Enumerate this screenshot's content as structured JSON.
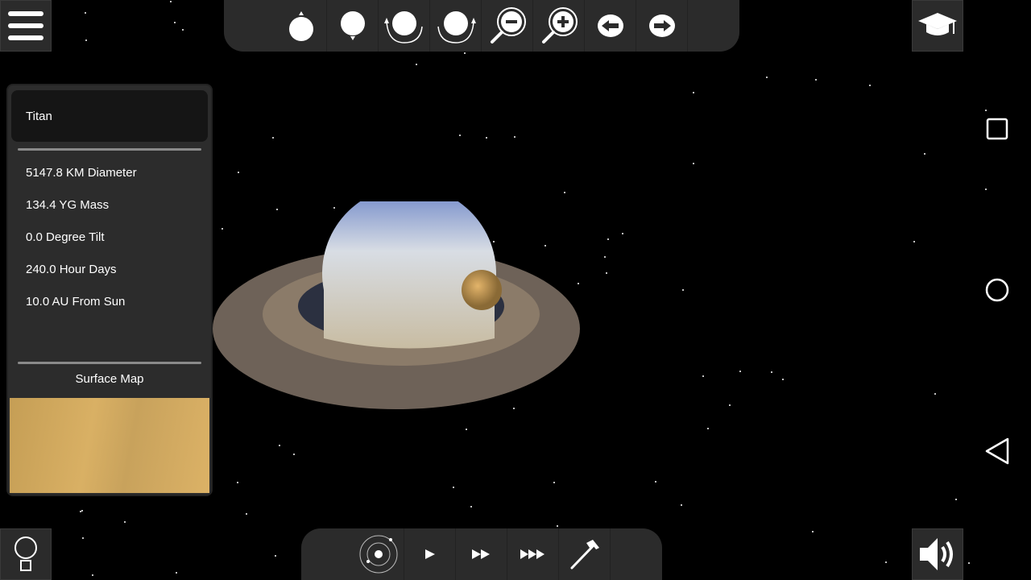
{
  "body": {
    "name": "Titan",
    "stats": [
      "5147.8 KM Diameter",
      "134.4 YG Mass",
      "0.0 Degree Tilt",
      "240.0 Hour Days",
      "10.0 AU From Sun"
    ],
    "surface_map_label": "Surface Map"
  },
  "toolbar_top": [
    "tilt-up-icon",
    "tilt-down-icon",
    "rotate-left-icon",
    "rotate-right-icon",
    "zoom-out-icon",
    "zoom-in-icon",
    "previous-arrow-icon",
    "next-arrow-icon"
  ],
  "toolbar_bottom": [
    "orbit-view-icon",
    "play-icon",
    "fast-forward-icon",
    "faster-forward-icon",
    "hammer-icon"
  ],
  "colors": {
    "panel": "#2c2c2c",
    "surface": "#c9a45a"
  }
}
